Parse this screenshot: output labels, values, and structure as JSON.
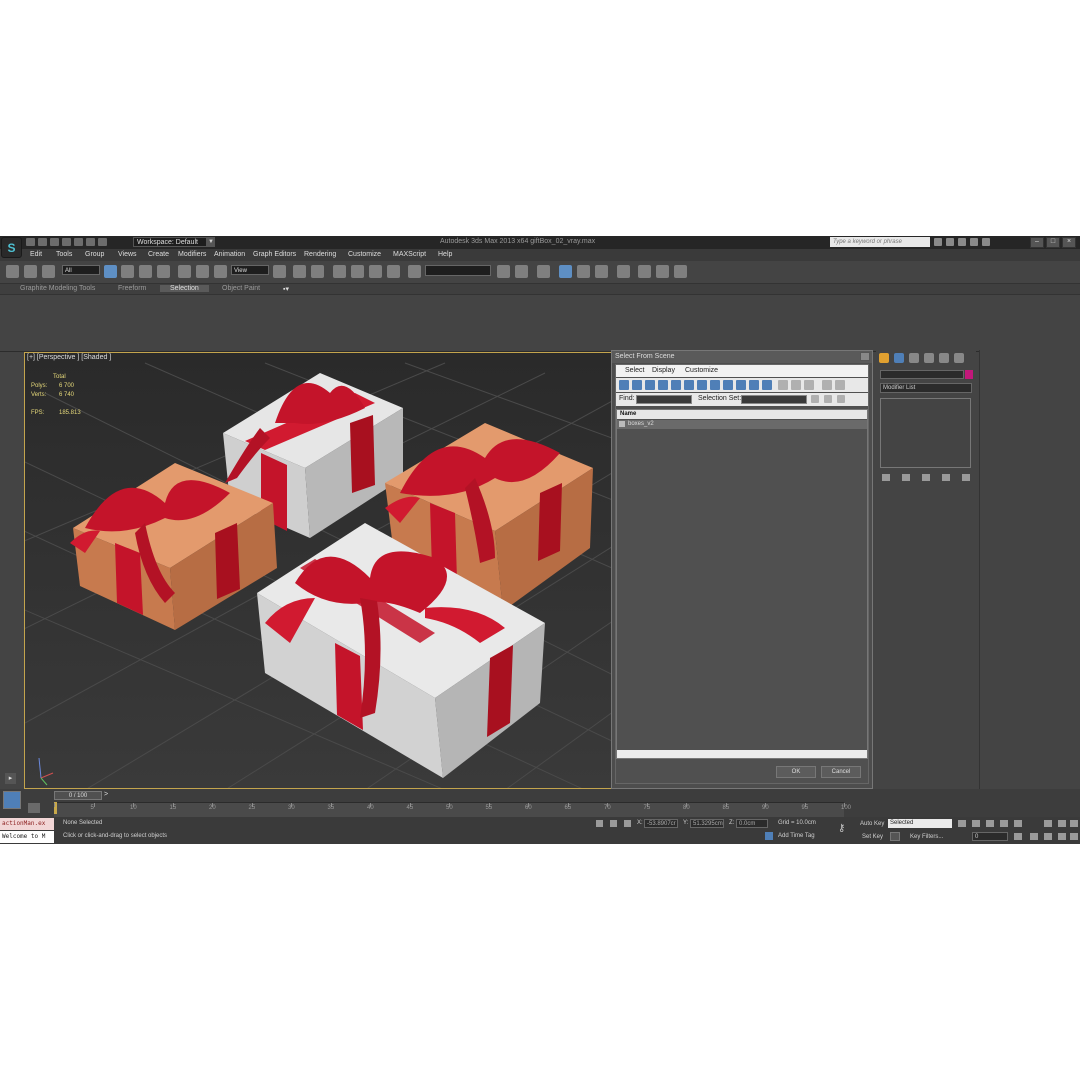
{
  "titlebar": {
    "workspace": "Workspace: Default",
    "app_title": "Autodesk 3ds Max 2013 x64    giftBox_02_vray.max",
    "search_placeholder": "Type a keyword or phrase"
  },
  "menu": [
    "Edit",
    "Tools",
    "Group",
    "Views",
    "Create",
    "Modifiers",
    "Animation",
    "Graph Editors",
    "Rendering",
    "Customize",
    "MAXScript",
    "Help"
  ],
  "toolbar": {
    "selection_filter": "All",
    "reference_coord": "View"
  },
  "ribbon_tabs": [
    "Graphite Modeling Tools",
    "Freeform",
    "Selection",
    "Object Paint"
  ],
  "viewport": {
    "label": "[+] [Perspective ] [Shaded ]",
    "stats": {
      "total_label": "Total",
      "polys_label": "Polys:",
      "polys_value": "6 700",
      "verts_label": "Verts:",
      "verts_value": "6 740",
      "fps_label": "FPS:",
      "fps_value": "185.813"
    }
  },
  "dialog": {
    "title": "Select From Scene",
    "menu": [
      "Select",
      "Display",
      "Customize"
    ],
    "find_label": "Find:",
    "selection_set_label": "Selection Set:",
    "column_header": "Name",
    "rows": [
      "boxes_v2"
    ],
    "ok": "OK",
    "cancel": "Cancel"
  },
  "command_panel": {
    "modifier_list": "Modifier List",
    "object_color": "#c2187a"
  },
  "timeline": {
    "slider": "0 / 100",
    "ticks": [
      "0",
      "5",
      "10",
      "15",
      "20",
      "25",
      "30",
      "35",
      "40",
      "45",
      "50",
      "55",
      "60",
      "65",
      "70",
      "75",
      "80",
      "85",
      "90",
      "95",
      "100"
    ]
  },
  "status": {
    "script_line1": "actionMan.ex",
    "script_line2": "Welcome to M",
    "selection": "None Selected",
    "prompt": "Click or click-and-drag to select objects",
    "x_label": "X:",
    "x_value": "-53.8907cr",
    "y_label": "Y:",
    "y_value": "51.3295cm",
    "z_label": "Z:",
    "z_value": "0.0cm",
    "grid": "Grid = 10.0cm",
    "add_time_tag": "Add Time Tag",
    "auto_key": "Auto Key",
    "set_key": "Set Key",
    "key_mode": "Selected",
    "key_filters": "Key Filters...",
    "frame": "0"
  },
  "colors": {
    "viewport_border": "#c3a44d",
    "ribbon_red": "#c4142a",
    "box_orange": "#d98a5c",
    "box_white": "#dcdcdc"
  }
}
